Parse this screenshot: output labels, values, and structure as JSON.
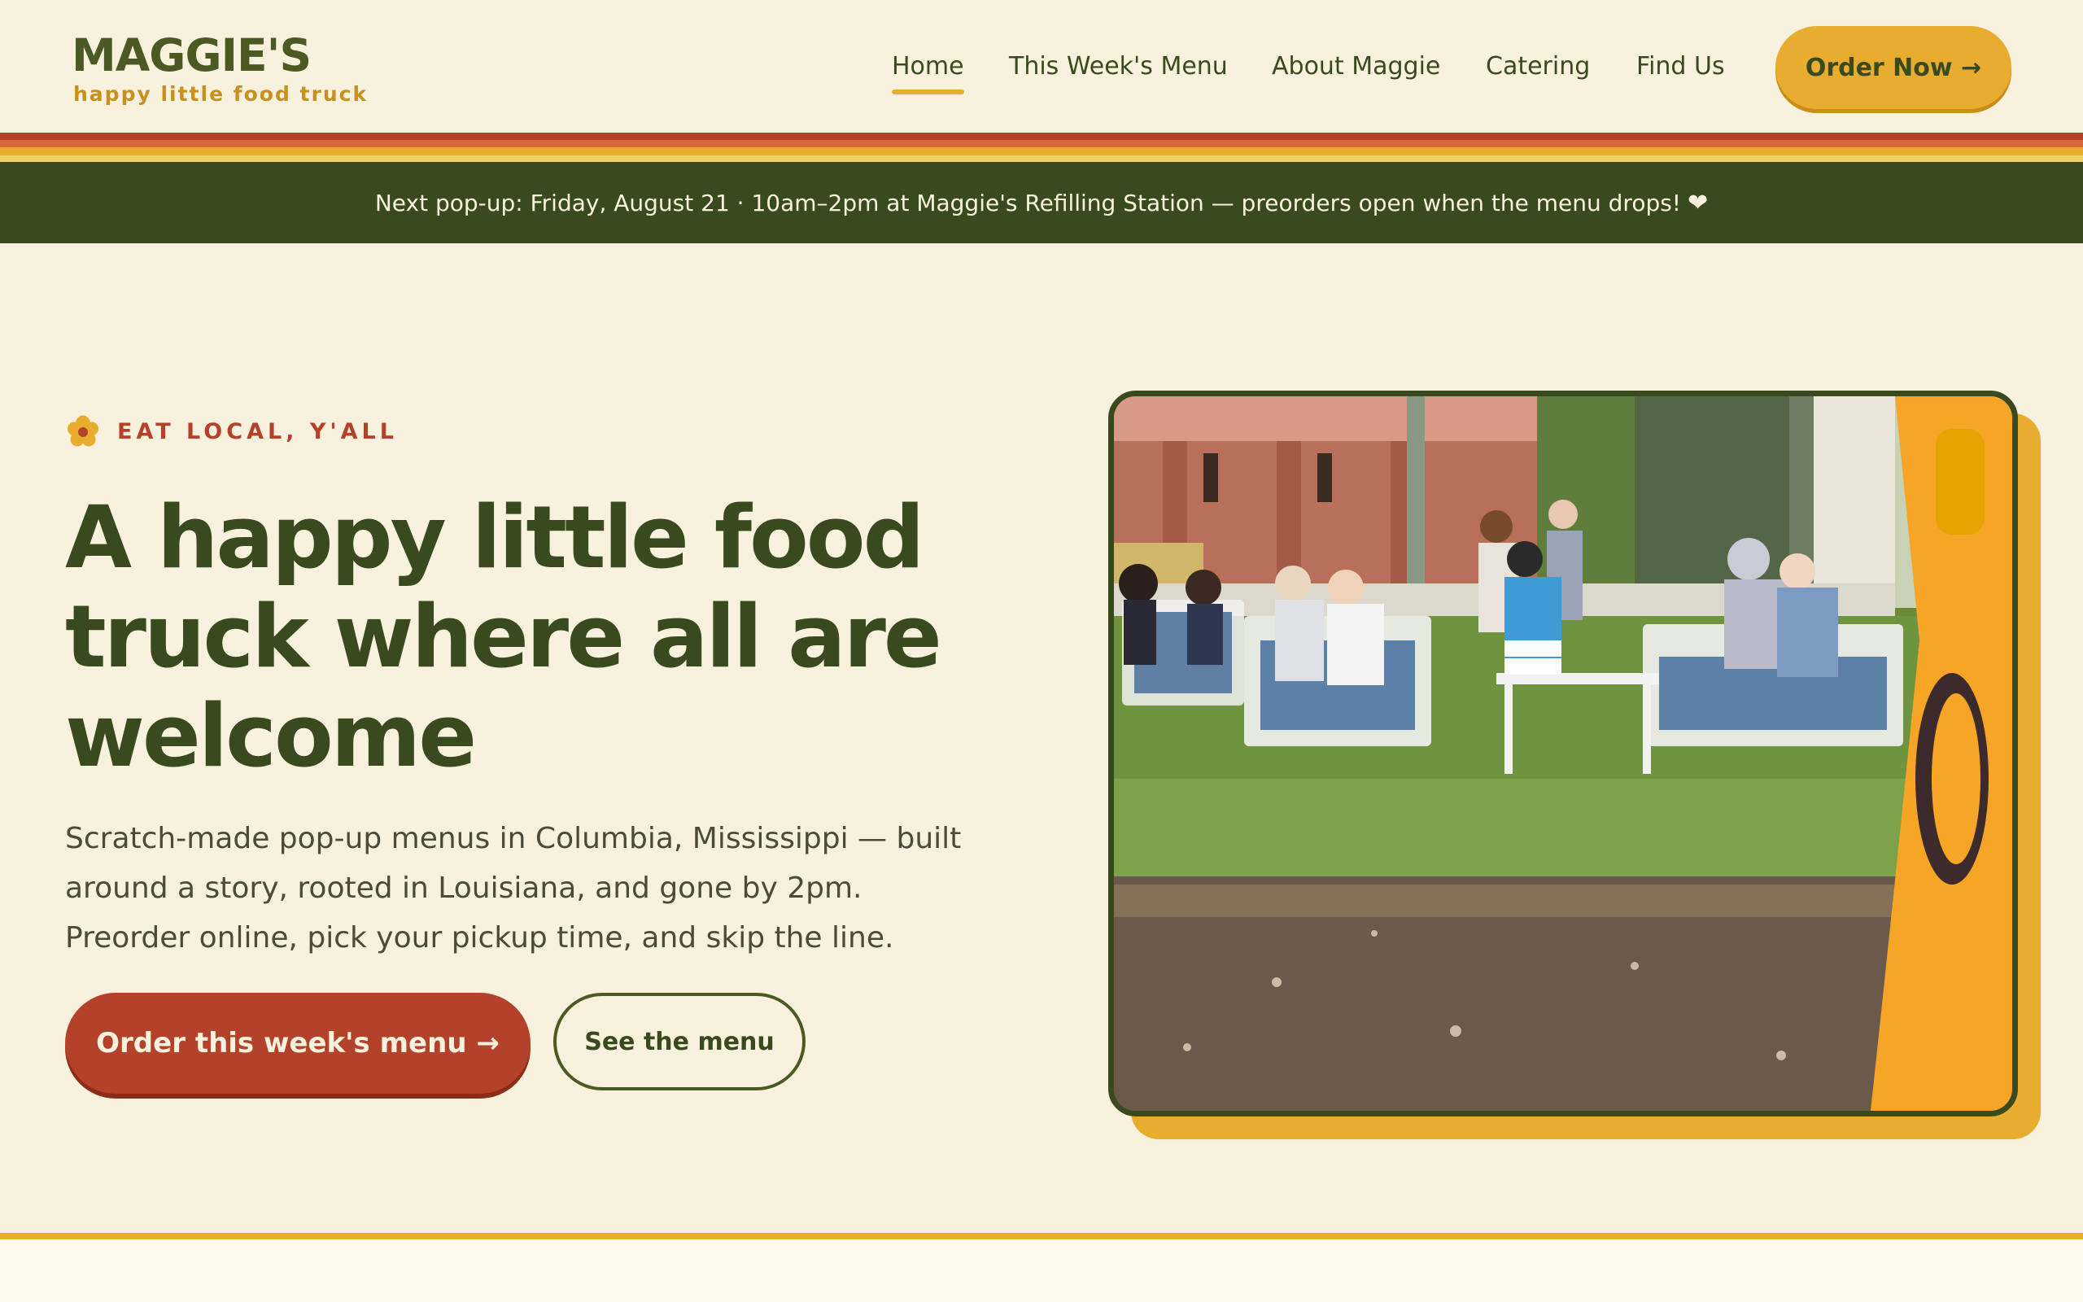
{
  "brand": {
    "name": "MAGGIE'S",
    "tagline": "happy little food truck"
  },
  "nav": {
    "items": [
      {
        "label": "Home",
        "active": true
      },
      {
        "label": "This Week's Menu",
        "active": false
      },
      {
        "label": "About Maggie",
        "active": false
      },
      {
        "label": "Catering",
        "active": false
      },
      {
        "label": "Find Us",
        "active": false
      }
    ],
    "cta_label": "Order Now →"
  },
  "announcement": {
    "text": "Next pop-up: Friday, August 21 · 10am–2pm at Maggie's Refilling Station — preorders open when the menu drops!",
    "icon": "heart-icon",
    "heart_glyph": "❤"
  },
  "hero": {
    "eyebrow_icon": "flower-icon",
    "eyebrow": "EAT LOCAL, Y'ALL",
    "headline": "A happy little food truck where all are welcome",
    "intro": "Scratch-made pop-up menus in Columbia, Mississippi — built around a story, rooted in Louisiana, and gone by 2pm. Preorder online, pick your pickup time, and skip the line.",
    "primary_cta": "Order this week's menu →",
    "secondary_cta": "See the menu"
  },
  "colors": {
    "background": "#f8f1dd",
    "olive": "#3a4a1f",
    "mustard": "#e8ad2e",
    "brick": "#b4422a"
  }
}
